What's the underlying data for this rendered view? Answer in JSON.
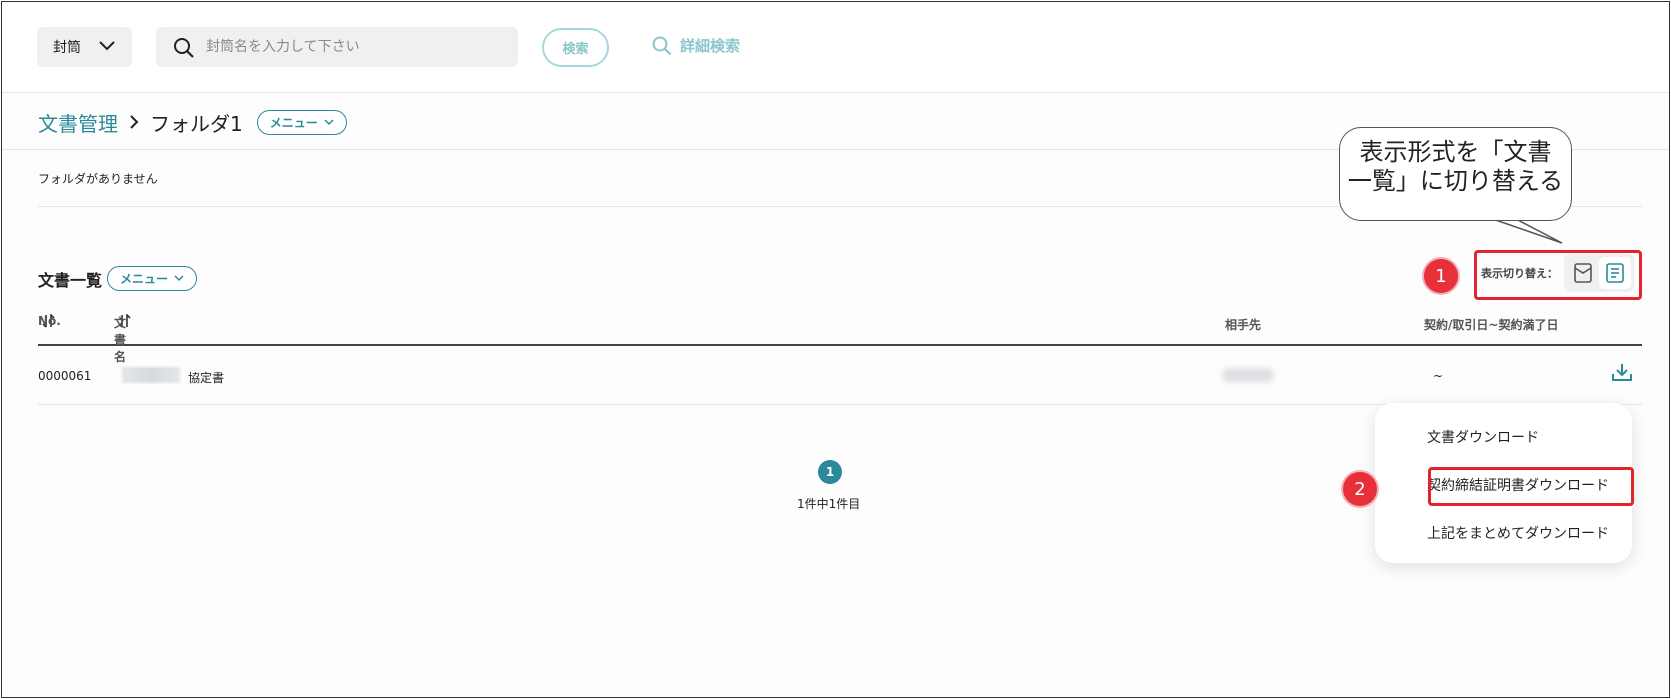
{
  "topbar": {
    "type_select_label": "封筒",
    "search_placeholder": "封筒名を入力して下さい",
    "search_button": "検索",
    "advanced_search": "詳細検索"
  },
  "breadcrumb": {
    "root": "文書管理",
    "separator": ">",
    "current": "フォルダ1",
    "menu_label": "メニュー"
  },
  "folders": {
    "empty_message": "フォルダがありません"
  },
  "document_list": {
    "title": "文書一覧",
    "menu_label": "メニュー",
    "view_toggle_label": "表示切り替え：",
    "columns": {
      "no": "No.",
      "name": "文書名",
      "partner": "相手先",
      "date": "契約/取引日~契約満了日"
    },
    "rows": [
      {
        "no": "0000061",
        "name": "協定書",
        "date": "~"
      }
    ],
    "pagination": {
      "current_page": "1",
      "count_text": "1件中1件目"
    }
  },
  "download_menu": {
    "items": [
      "文書ダウンロード",
      "契約締結証明書ダウンロード",
      "上記をまとめてダウンロード"
    ]
  },
  "annotations": {
    "callout_line1": "表示形式を「文書",
    "callout_line2": "一覧」に切り替える",
    "marker1": "1",
    "marker2": "2"
  },
  "colors": {
    "accent": "#2b8a9a",
    "annotation_red": "#e0262a",
    "muted_accent": "#8cc6ce"
  }
}
